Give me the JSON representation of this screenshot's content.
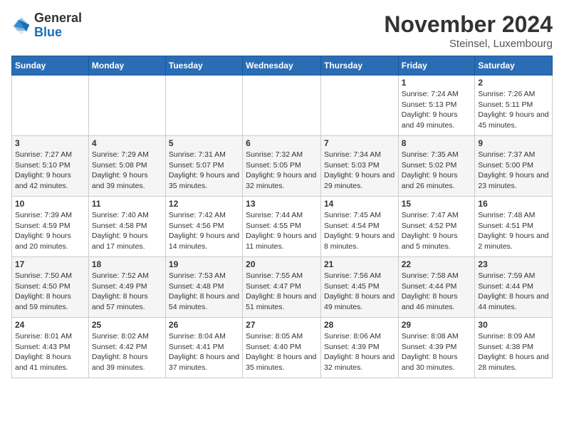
{
  "header": {
    "logo_general": "General",
    "logo_blue": "Blue",
    "month_year": "November 2024",
    "location": "Steinsel, Luxembourg"
  },
  "days_of_week": [
    "Sunday",
    "Monday",
    "Tuesday",
    "Wednesday",
    "Thursday",
    "Friday",
    "Saturday"
  ],
  "weeks": [
    [
      {
        "day": "",
        "info": ""
      },
      {
        "day": "",
        "info": ""
      },
      {
        "day": "",
        "info": ""
      },
      {
        "day": "",
        "info": ""
      },
      {
        "day": "",
        "info": ""
      },
      {
        "day": "1",
        "info": "Sunrise: 7:24 AM\nSunset: 5:13 PM\nDaylight: 9 hours and 49 minutes."
      },
      {
        "day": "2",
        "info": "Sunrise: 7:26 AM\nSunset: 5:11 PM\nDaylight: 9 hours and 45 minutes."
      }
    ],
    [
      {
        "day": "3",
        "info": "Sunrise: 7:27 AM\nSunset: 5:10 PM\nDaylight: 9 hours and 42 minutes."
      },
      {
        "day": "4",
        "info": "Sunrise: 7:29 AM\nSunset: 5:08 PM\nDaylight: 9 hours and 39 minutes."
      },
      {
        "day": "5",
        "info": "Sunrise: 7:31 AM\nSunset: 5:07 PM\nDaylight: 9 hours and 35 minutes."
      },
      {
        "day": "6",
        "info": "Sunrise: 7:32 AM\nSunset: 5:05 PM\nDaylight: 9 hours and 32 minutes."
      },
      {
        "day": "7",
        "info": "Sunrise: 7:34 AM\nSunset: 5:03 PM\nDaylight: 9 hours and 29 minutes."
      },
      {
        "day": "8",
        "info": "Sunrise: 7:35 AM\nSunset: 5:02 PM\nDaylight: 9 hours and 26 minutes."
      },
      {
        "day": "9",
        "info": "Sunrise: 7:37 AM\nSunset: 5:00 PM\nDaylight: 9 hours and 23 minutes."
      }
    ],
    [
      {
        "day": "10",
        "info": "Sunrise: 7:39 AM\nSunset: 4:59 PM\nDaylight: 9 hours and 20 minutes."
      },
      {
        "day": "11",
        "info": "Sunrise: 7:40 AM\nSunset: 4:58 PM\nDaylight: 9 hours and 17 minutes."
      },
      {
        "day": "12",
        "info": "Sunrise: 7:42 AM\nSunset: 4:56 PM\nDaylight: 9 hours and 14 minutes."
      },
      {
        "day": "13",
        "info": "Sunrise: 7:44 AM\nSunset: 4:55 PM\nDaylight: 9 hours and 11 minutes."
      },
      {
        "day": "14",
        "info": "Sunrise: 7:45 AM\nSunset: 4:54 PM\nDaylight: 9 hours and 8 minutes."
      },
      {
        "day": "15",
        "info": "Sunrise: 7:47 AM\nSunset: 4:52 PM\nDaylight: 9 hours and 5 minutes."
      },
      {
        "day": "16",
        "info": "Sunrise: 7:48 AM\nSunset: 4:51 PM\nDaylight: 9 hours and 2 minutes."
      }
    ],
    [
      {
        "day": "17",
        "info": "Sunrise: 7:50 AM\nSunset: 4:50 PM\nDaylight: 8 hours and 59 minutes."
      },
      {
        "day": "18",
        "info": "Sunrise: 7:52 AM\nSunset: 4:49 PM\nDaylight: 8 hours and 57 minutes."
      },
      {
        "day": "19",
        "info": "Sunrise: 7:53 AM\nSunset: 4:48 PM\nDaylight: 8 hours and 54 minutes."
      },
      {
        "day": "20",
        "info": "Sunrise: 7:55 AM\nSunset: 4:47 PM\nDaylight: 8 hours and 51 minutes."
      },
      {
        "day": "21",
        "info": "Sunrise: 7:56 AM\nSunset: 4:45 PM\nDaylight: 8 hours and 49 minutes."
      },
      {
        "day": "22",
        "info": "Sunrise: 7:58 AM\nSunset: 4:44 PM\nDaylight: 8 hours and 46 minutes."
      },
      {
        "day": "23",
        "info": "Sunrise: 7:59 AM\nSunset: 4:44 PM\nDaylight: 8 hours and 44 minutes."
      }
    ],
    [
      {
        "day": "24",
        "info": "Sunrise: 8:01 AM\nSunset: 4:43 PM\nDaylight: 8 hours and 41 minutes."
      },
      {
        "day": "25",
        "info": "Sunrise: 8:02 AM\nSunset: 4:42 PM\nDaylight: 8 hours and 39 minutes."
      },
      {
        "day": "26",
        "info": "Sunrise: 8:04 AM\nSunset: 4:41 PM\nDaylight: 8 hours and 37 minutes."
      },
      {
        "day": "27",
        "info": "Sunrise: 8:05 AM\nSunset: 4:40 PM\nDaylight: 8 hours and 35 minutes."
      },
      {
        "day": "28",
        "info": "Sunrise: 8:06 AM\nSunset: 4:39 PM\nDaylight: 8 hours and 32 minutes."
      },
      {
        "day": "29",
        "info": "Sunrise: 8:08 AM\nSunset: 4:39 PM\nDaylight: 8 hours and 30 minutes."
      },
      {
        "day": "30",
        "info": "Sunrise: 8:09 AM\nSunset: 4:38 PM\nDaylight: 8 hours and 28 minutes."
      }
    ]
  ]
}
